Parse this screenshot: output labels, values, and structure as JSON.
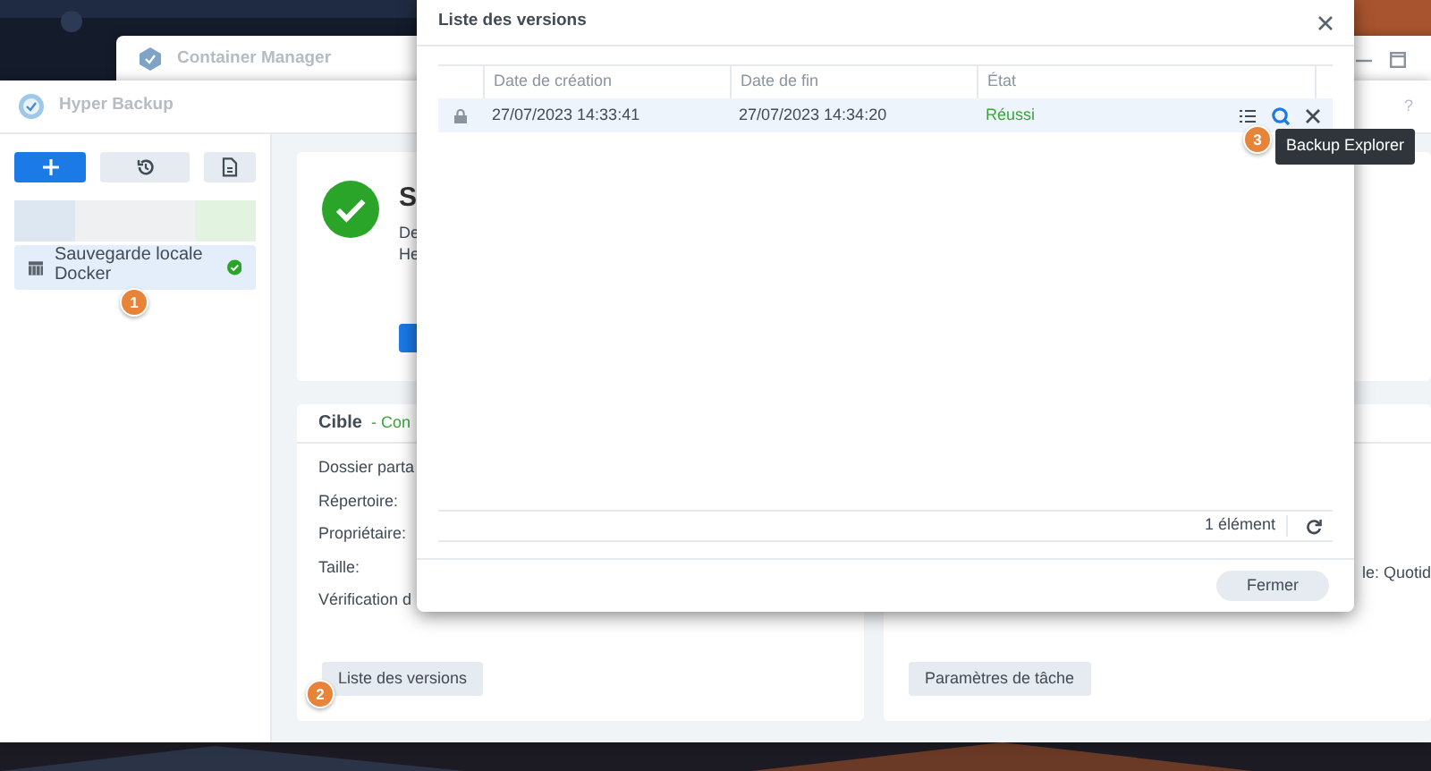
{
  "background_window": {
    "title": "Container Manager"
  },
  "app_window": {
    "title": "Hyper Backup",
    "help": "?",
    "tasks": [
      {
        "name": "Sauvegarde locale Docker",
        "selected": true,
        "step_badge": "1"
      }
    ],
    "summary": {
      "title": "S",
      "line_1": "De",
      "line_2": "He"
    },
    "target_card": {
      "title": "Cible",
      "status": "- Con",
      "fields": [
        "Dossier parta",
        "Répertoire:",
        "Propriétaire:",
        "Taille:",
        "Vérification d"
      ],
      "button": "Liste des versions",
      "step_badge": "2"
    },
    "schedule_card": {
      "field": "le: Quotid",
      "button": "Paramètres de tâche"
    }
  },
  "dialog": {
    "title": "Liste des versions",
    "columns": [
      "Date de création",
      "Date de fin",
      "État"
    ],
    "rows": [
      {
        "locked": true,
        "created": "27/07/2023 14:33:41",
        "ended": "27/07/2023 14:34:20",
        "status": "Réussi",
        "selected": true,
        "step_badge": "3"
      }
    ],
    "tooltip": "Backup Explorer",
    "count": "1 élément",
    "close_button": "Fermer"
  }
}
